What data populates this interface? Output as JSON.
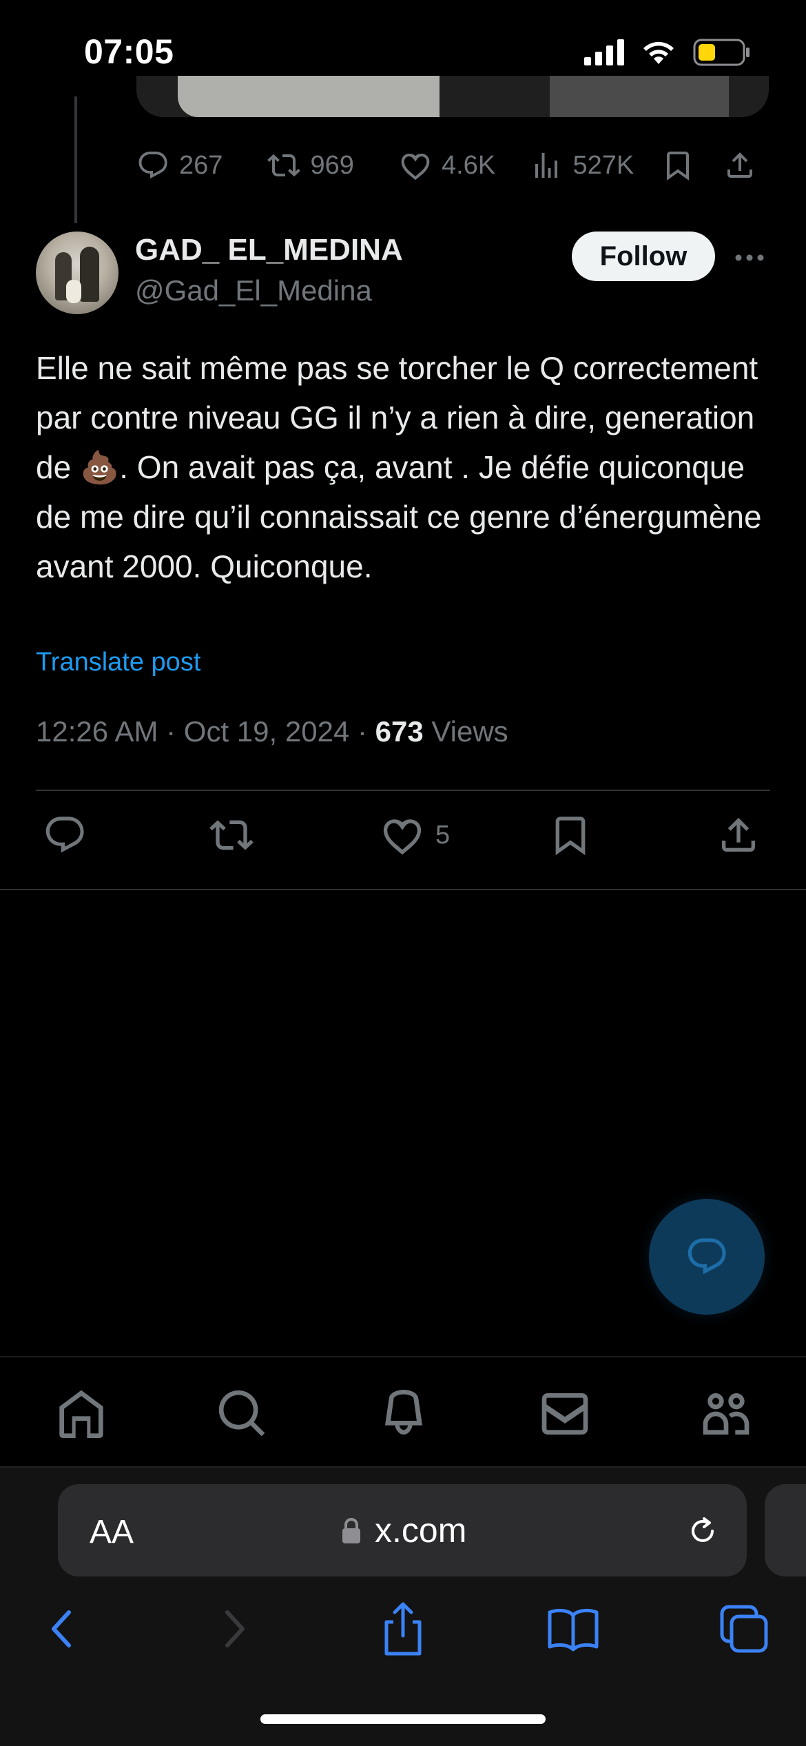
{
  "status_bar": {
    "time": "07:05"
  },
  "previous_tweet": {
    "replies": "267",
    "reposts": "969",
    "likes": "4.6K",
    "views": "527K"
  },
  "tweet": {
    "display_name": "GAD_ EL_MEDINA",
    "handle": "@Gad_El_Medina",
    "follow_label": "Follow",
    "text": "Elle ne sait même pas se torcher le Q correctement par contre niveau GG il n’y a rien à dire, generation de 💩. On avait pas ça, avant . Je défie quiconque de me dire qu’il connaissait ce genre d’énergumène avant 2000. Quiconque.",
    "translate_label": "Translate post",
    "time": "12:26 AM",
    "date": "Oct 19, 2024",
    "views_count": "673",
    "views_label": "Views",
    "likes": "5"
  },
  "browser": {
    "aa_label": "AA",
    "url": "x.com"
  },
  "colors": {
    "background": "#000000",
    "accent": "#1d9bf0",
    "muted": "#71767b"
  }
}
